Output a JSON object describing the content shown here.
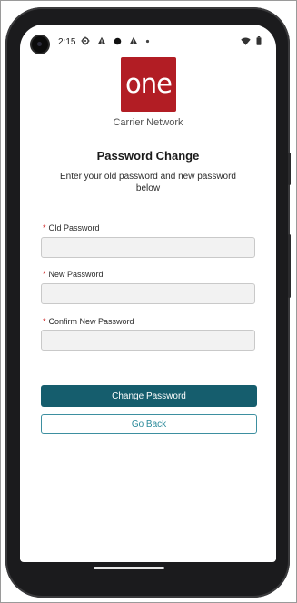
{
  "status_bar": {
    "time": "2:15",
    "left_icons": [
      "settings-icon",
      "warning-icon",
      "record-dot-icon",
      "warning-icon",
      "small-dot-icon"
    ],
    "right_icons": [
      "wifi-icon",
      "battery-icon"
    ]
  },
  "brand": {
    "logo_text": "one",
    "logo_color": "#b21d24",
    "subtitle": "Carrier Network"
  },
  "page": {
    "title": "Password Change",
    "subtitle": "Enter your old password and new password below"
  },
  "form": {
    "required_marker": "*",
    "old_password": {
      "label": "Old Password",
      "value": "",
      "placeholder": ""
    },
    "new_password": {
      "label": "New Password",
      "value": "",
      "placeholder": ""
    },
    "confirm_password": {
      "label": "Confirm New Password",
      "value": "",
      "placeholder": ""
    }
  },
  "actions": {
    "submit_label": "Change Password",
    "back_label": "Go Back",
    "primary_color": "#155d6d",
    "secondary_color": "#2a8a9a"
  }
}
